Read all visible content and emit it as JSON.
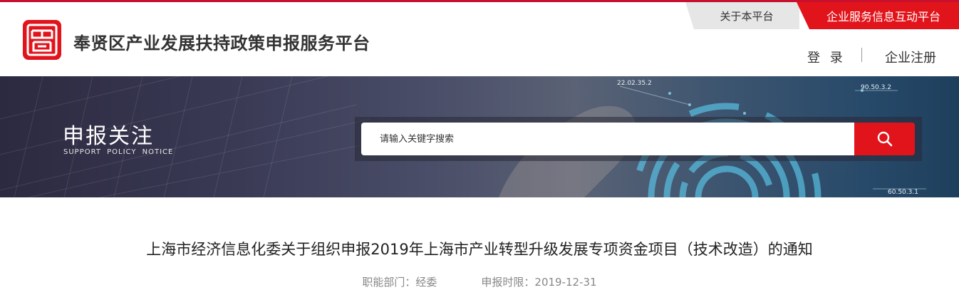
{
  "header": {
    "site_title": "奉贤区产业发展扶持政策申报服务平台",
    "logo_icon": "seal-logo-icon",
    "top_tabs": {
      "about": "关于本平台",
      "enterprise_platform": "企业服务信息互动平台"
    },
    "auth": {
      "login": "登 录",
      "register": "企业注册"
    }
  },
  "banner": {
    "title": "申报关注",
    "subtitle": "SUPPORT  POLICY  NOTICE",
    "decor_labels": [
      "22.02.35.2",
      "90.50.3.2",
      "60.50.3.1"
    ],
    "search": {
      "placeholder": "请输入关键字搜索",
      "button_icon": "search-icon"
    }
  },
  "article": {
    "title": "上海市经济信息化委关于组织申报2019年上海市产业转型升级发展专项资金项目（技术改造）的通知",
    "department_label": "职能部门：",
    "department": "经委",
    "deadline_label": "申报时限：",
    "deadline": "2019-12-31"
  },
  "colors": {
    "brand_red": "#e2141b",
    "tab_gray": "#e6e6e6",
    "meta_gray": "#888888"
  }
}
